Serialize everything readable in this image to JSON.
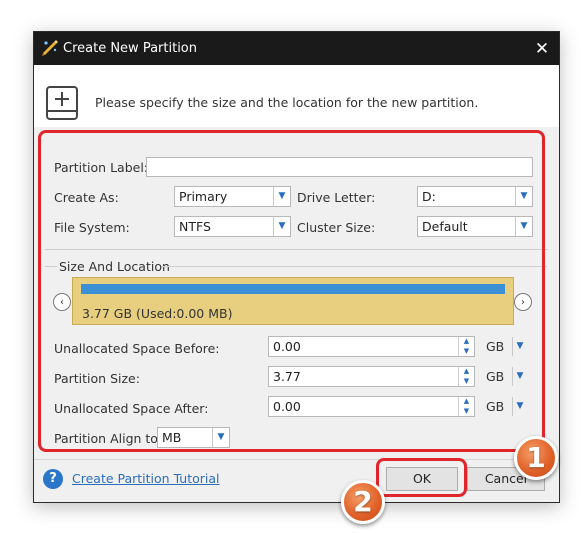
{
  "window": {
    "title": "Create New Partition",
    "close_glyph": "✕"
  },
  "header": {
    "message": "Please specify the size and the location for the new partition."
  },
  "form": {
    "partition_label": {
      "label": "Partition Label:",
      "value": ""
    },
    "create_as": {
      "label": "Create As:",
      "value": "Primary"
    },
    "drive_letter": {
      "label": "Drive Letter:",
      "value": "D:"
    },
    "file_system": {
      "label": "File System:",
      "value": "NTFS"
    },
    "cluster_size": {
      "label": "Cluster Size:",
      "value": "Default"
    }
  },
  "size_location": {
    "group_title": "Size And Location",
    "partition_info": "3.77 GB (Used:0.00 MB)",
    "unallocated_before": {
      "label": "Unallocated Space Before:",
      "value": "0.00",
      "unit": "GB"
    },
    "partition_size": {
      "label": "Partition Size:",
      "value": "3.77",
      "unit": "GB"
    },
    "unallocated_after": {
      "label": "Unallocated Space After:",
      "value": "0.00",
      "unit": "GB"
    },
    "align": {
      "label": "Partition Align to:",
      "value": "MB"
    }
  },
  "footer": {
    "help_glyph": "?",
    "tutorial_link": "Create Partition Tutorial",
    "ok_label": "OK",
    "cancel_label": "Cancel"
  },
  "annotations": {
    "badge_1": "1",
    "badge_2": "2"
  },
  "icons": {
    "nav_left": "‹",
    "nav_right": "›",
    "dropdown": "▼",
    "spin_up": "▲",
    "spin_down": "▼"
  },
  "colors": {
    "titlebar": "#1a1a1a",
    "partition_block": "#e8cf80",
    "partition_bar": "#3b8fd5",
    "highlight": "#e0262b",
    "badge": "#e2632a",
    "link": "#2a6ebd"
  }
}
